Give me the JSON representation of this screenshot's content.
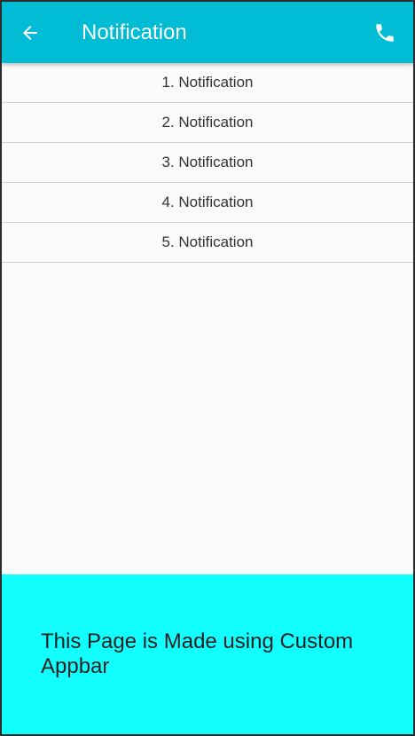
{
  "appbar": {
    "title": "Notification",
    "back_icon": "arrow-left-icon",
    "action_icon": "phone-icon",
    "color": "#00bcd4"
  },
  "list": {
    "items": [
      {
        "label": "1. Notification"
      },
      {
        "label": "2. Notification"
      },
      {
        "label": "3. Notification"
      },
      {
        "label": "4. Notification"
      },
      {
        "label": "5. Notification"
      }
    ]
  },
  "footer": {
    "text": "This Page is Made using Custom Appbar",
    "color": "#12ffff"
  }
}
